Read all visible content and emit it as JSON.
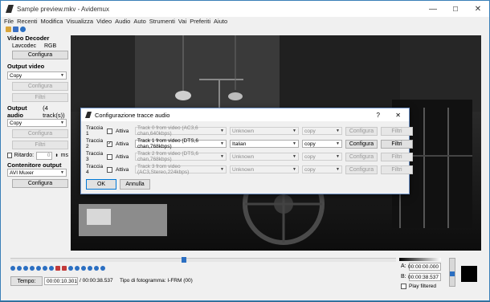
{
  "window": {
    "title": "Sample preview.mkv - Avidemux",
    "minimize": "—",
    "maximize": "☐",
    "close": "✕"
  },
  "menu": [
    "File",
    "Recenti",
    "Modifica",
    "Visualizza",
    "Video",
    "Audio",
    "Auto",
    "Strumenti",
    "Vai",
    "Preferiti",
    "Aiuto"
  ],
  "left": {
    "video_decoder_title": "Video Decoder",
    "lavcodec": "Lavcodec",
    "rgb": "RGB",
    "configura1": "Configura",
    "output_video_title": "Output video",
    "output_video_value": "Copy",
    "configura2": "Configura",
    "filtri1": "Filtri",
    "output_audio_title": "Output audio",
    "output_audio_tracks": "(4 track(s))",
    "output_audio_value": "Copy",
    "configura3": "Configura",
    "filtri2": "Filtri",
    "ritardo_label": "Ritardo:",
    "ritardo_value": "0",
    "ritardo_unit": "ms",
    "container_title": "Contenitore output",
    "container_value": "AVI Muxer",
    "configura4": "Configura"
  },
  "dialog": {
    "title": "Configurazione tracce audio",
    "help": "?",
    "close": "✕",
    "tracks": [
      {
        "label": "Traccia 1",
        "active_label": "Attiva",
        "checked": false,
        "source": "Track 0 from video (AC3,6 chan,640kbps)",
        "language": "Unknown",
        "codec": "copy",
        "configura": "Configura",
        "filtri": "Filtri",
        "enabled": false
      },
      {
        "label": "Traccia 2",
        "active_label": "Attiva",
        "checked": true,
        "source": "Track 1 from video (DTS,6 chan,768kbps)",
        "language": "Italian",
        "codec": "copy",
        "configura": "Configura",
        "filtri": "Filtri",
        "enabled": true
      },
      {
        "label": "Traccia 3",
        "active_label": "Attiva",
        "checked": false,
        "source": "Track 2 from video (DTS,6 chan,768kbps)",
        "language": "Unknown",
        "codec": "copy",
        "configura": "Configura",
        "filtri": "Filtri",
        "enabled": false
      },
      {
        "label": "Traccia 4",
        "active_label": "Attiva",
        "checked": false,
        "source": "Track 3 from video (AC3,Stereo,224kbps)",
        "language": "Unknown",
        "codec": "copy",
        "configura": "Configura",
        "filtri": "Filtri",
        "enabled": false
      }
    ],
    "ok": "OK",
    "annulla": "Annulla"
  },
  "bottom": {
    "tempo_button": "Tempo:",
    "current_time": "00:00:10.301",
    "total_time": "/ 00:00:38.537",
    "frame_type": "Tipo di fotogramma: I-FRM (00)",
    "a_label": "A:",
    "a_value": "00:00:00.000",
    "b_label": "B:",
    "b_value": "00:00:38.537",
    "play_filtered": "Play filtered"
  },
  "colors": {
    "accent": "#2b6fc2",
    "title_border": "#3a7fb8"
  }
}
